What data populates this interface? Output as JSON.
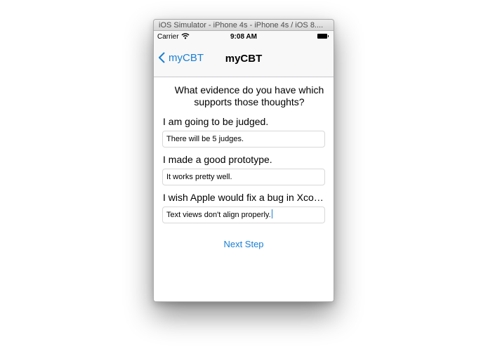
{
  "window": {
    "title": "iOS Simulator - iPhone 4s - iPhone 4s / iOS 8...."
  },
  "statusbar": {
    "carrier": "Carrier",
    "time": "9:08 AM",
    "wifi_icon": "wifi-icon",
    "battery_icon": "battery-icon"
  },
  "navbar": {
    "back_label": "myCBT",
    "back_icon": "chevron-left-icon",
    "title": "myCBT",
    "tint_color": "#1a7fd4"
  },
  "content": {
    "question": "What evidence do you have which supports those thoughts?",
    "entries": [
      {
        "thought": "I am going to be judged.",
        "evidence": "There will be 5 judges."
      },
      {
        "thought": "I made a good prototype.",
        "evidence": "It works pretty well."
      },
      {
        "thought": "I wish Apple would fix a bug in Xco…",
        "evidence": "Text views don't align properly."
      }
    ],
    "next_step_label": "Next Step"
  }
}
